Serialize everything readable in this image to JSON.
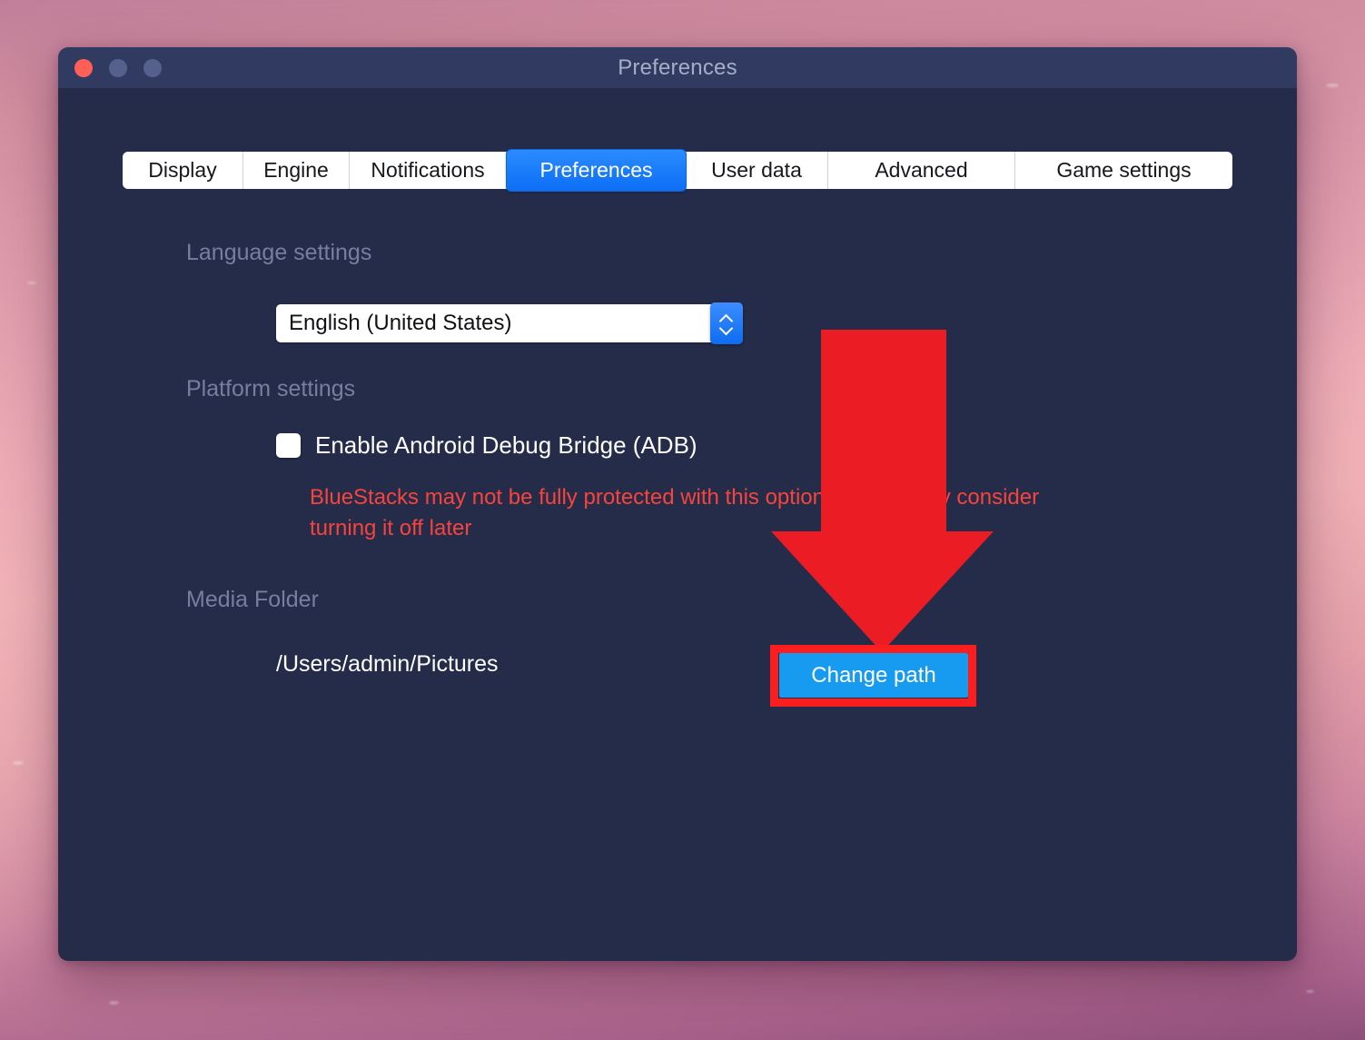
{
  "window": {
    "title": "Preferences",
    "traffic_lights": [
      "close-button",
      "minimize-button",
      "maximize-button"
    ]
  },
  "tabs": [
    {
      "label": "Display",
      "active": false
    },
    {
      "label": "Engine",
      "active": false
    },
    {
      "label": "Notifications",
      "active": false
    },
    {
      "label": "Preferences",
      "active": true
    },
    {
      "label": "User data",
      "active": false
    },
    {
      "label": "Advanced",
      "active": false
    },
    {
      "label": "Game settings",
      "active": false
    }
  ],
  "language": {
    "heading": "Language settings",
    "selected": "English (United States)"
  },
  "platform": {
    "heading": "Platform settings",
    "adb_label": "Enable Android Debug Bridge (ADB)",
    "adb_checked": false,
    "warning": "BlueStacks may not be fully protected with this option on. You may consider turning it off later"
  },
  "media": {
    "heading": "Media Folder",
    "path": "/Users/admin/Pictures",
    "change_button": "Change path"
  },
  "annotation": {
    "arrow_color": "#ec1c24",
    "highlight_color": "#fa1e1e",
    "target": "change-path-button"
  },
  "colors": {
    "titlebar": "#313b61",
    "window_body": "#242c49",
    "accent_blue": "#0c6ff5",
    "button_blue": "#179bf0",
    "warning_red": "#f7443c",
    "heading_gray": "#767f9e",
    "close_red": "#fe5f57"
  }
}
